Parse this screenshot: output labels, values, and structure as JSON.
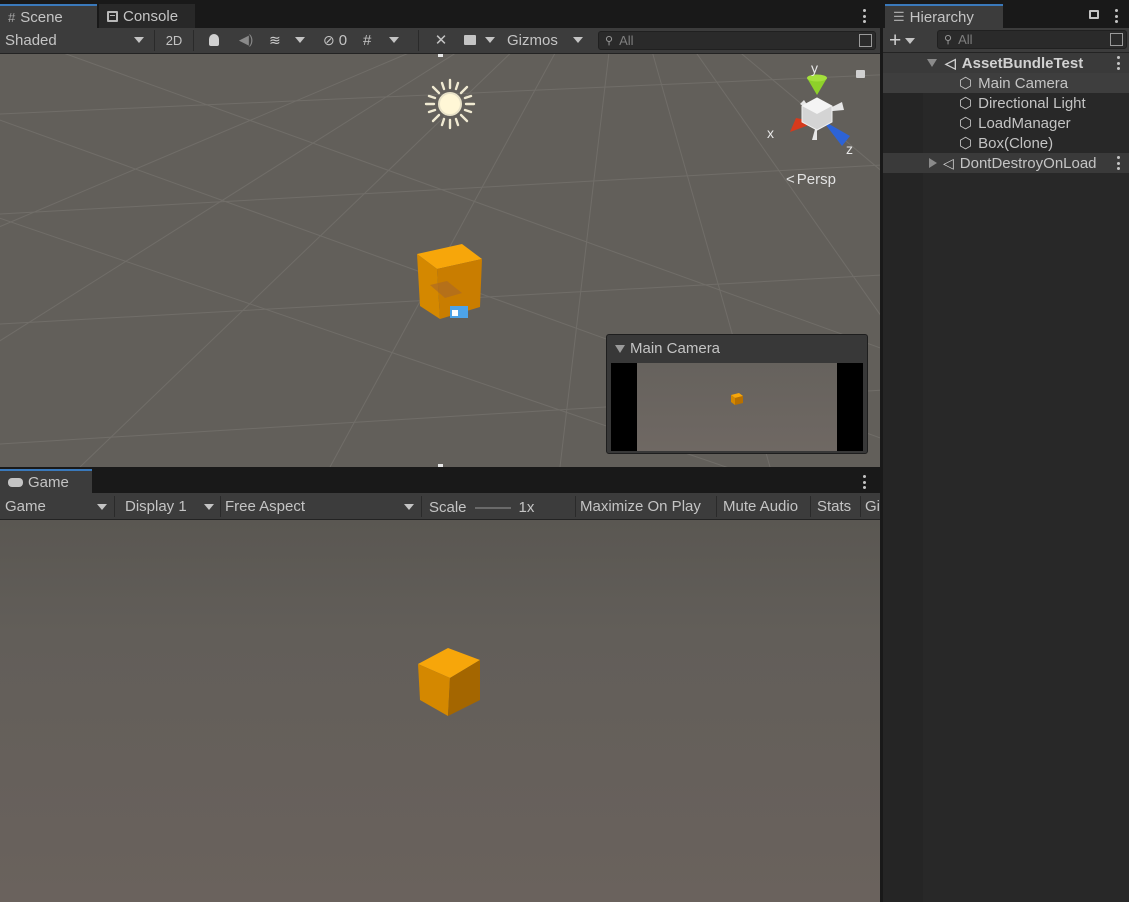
{
  "scene_tabs": [
    {
      "label": "Scene",
      "icon": "grid-icon",
      "active": true
    },
    {
      "label": "Console",
      "icon": "console-icon",
      "active": false
    }
  ],
  "scene_toolbar": {
    "shading_mode": "Shaded",
    "mode_2d": "2D",
    "hidden_count": "0",
    "gizmos_label": "Gizmos",
    "search_placeholder": "All"
  },
  "scene_view": {
    "axis_labels": {
      "x": "x",
      "y": "y",
      "z": "z"
    },
    "projection_label": "Persp",
    "camera_preview_title": "Main Camera"
  },
  "game_tab": {
    "label": "Game",
    "icon": "gamepad-icon"
  },
  "game_toolbar": {
    "view_mode": "Game",
    "display": "Display 1",
    "aspect": "Free Aspect",
    "scale_label": "Scale",
    "scale_value": "1x",
    "maximize_on_play": "Maximize On Play",
    "mute_audio": "Mute Audio",
    "stats": "Stats",
    "gizmos_truncated": "Gi"
  },
  "hierarchy": {
    "tab_label": "Hierarchy",
    "search_placeholder": "All",
    "scenes": [
      {
        "name": "AssetBundleTest",
        "expanded": true,
        "objects": [
          "Main Camera",
          "Directional Light",
          "LoadManager",
          "Box(Clone)"
        ]
      },
      {
        "name": "DontDestroyOnLoad",
        "expanded": false,
        "objects": []
      }
    ]
  },
  "colors": {
    "accent_tab": "#3a79bb",
    "cube_orange": "#f5a000",
    "axis_x_red": "#d63a1c",
    "axis_y_green": "#8ed12a",
    "axis_z_blue": "#2d63d6"
  }
}
